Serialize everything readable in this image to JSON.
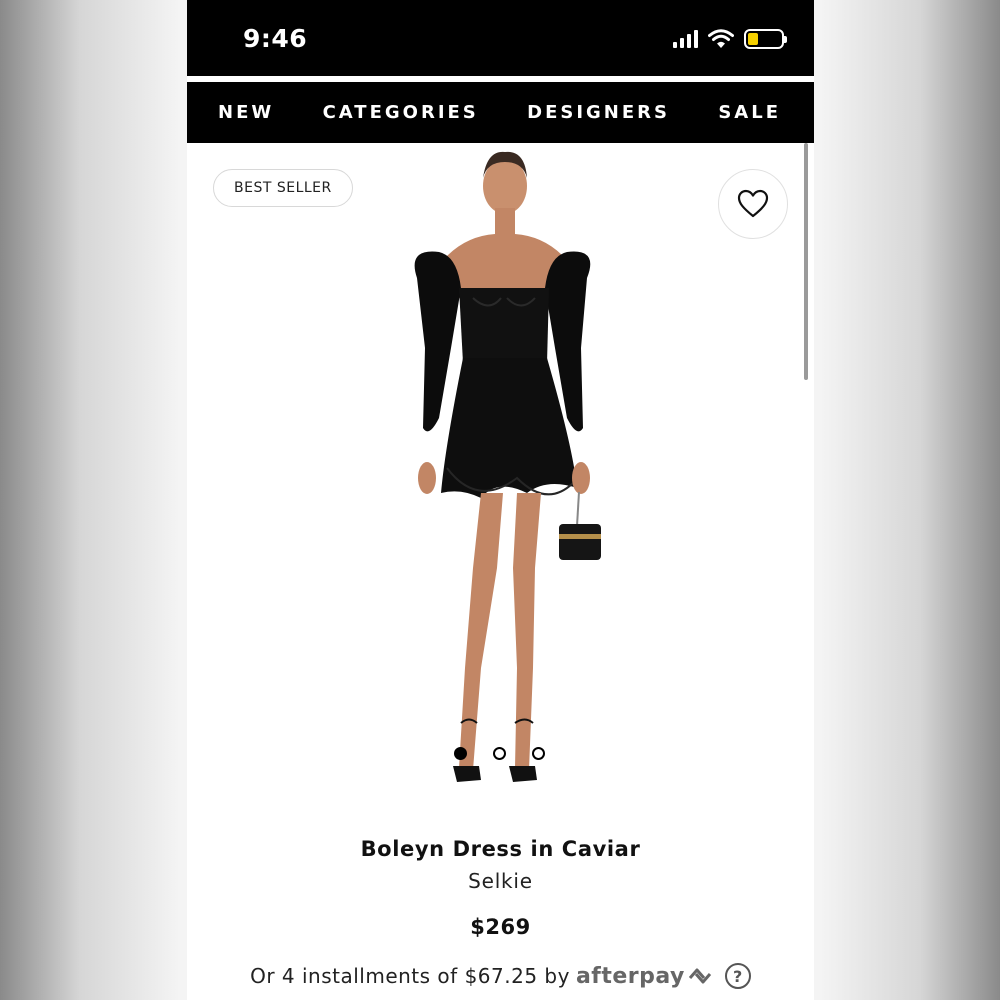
{
  "status_bar": {
    "time": "9:46",
    "icons": [
      "cellular-signal-icon",
      "wifi-icon",
      "battery-icon"
    ],
    "battery_color": "#f5d000"
  },
  "nav": {
    "items": [
      "NEW",
      "CATEGORIES",
      "DESIGNERS",
      "SALE"
    ]
  },
  "product": {
    "badge": "BEST SELLER",
    "title": "Boleyn Dress in Caviar",
    "brand": "Selkie",
    "price": "$269",
    "installments_text": "Or 4 installments of $67.25 by",
    "afterpay_label": "afterpay",
    "help_label": "?",
    "gallery": {
      "count": 3,
      "active": 1
    }
  },
  "colors": {
    "nav_background": "#000000",
    "nav_text": "#ffffff",
    "page_background": "#ffffff"
  }
}
